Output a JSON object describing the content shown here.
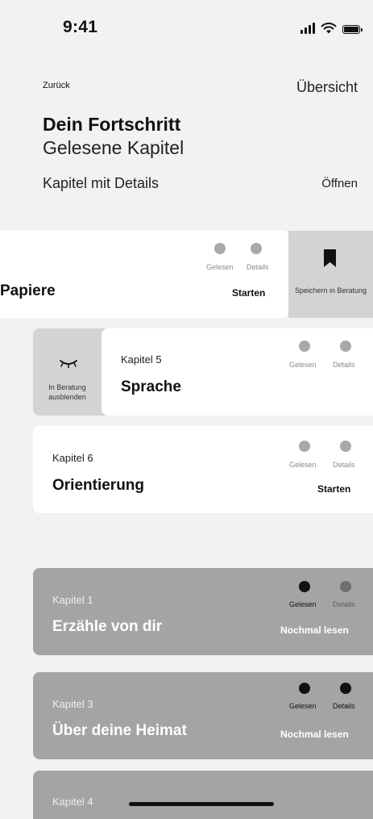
{
  "status_bar": {
    "time": "9:41"
  },
  "header": {
    "back": "Zurück",
    "overview": "Übersicht",
    "title": "Dein Fortschritt",
    "subtitle": "Gelesene Kapitel",
    "chapter_details": "Kapitel mit Details",
    "open": "Öffnen"
  },
  "cards": {
    "papiere": {
      "title": "Papiere",
      "read_label": "Gelesen",
      "details_label": "Details",
      "action": "Starten",
      "swipe_action": "Speichern in Beratung",
      "swipe_icon": "bookmark-icon"
    },
    "sprache": {
      "chapter": "Kapitel 5",
      "title": "Sprache",
      "read_label": "Gelesen",
      "details_label": "Details",
      "swipe_action": "In Beratung ausblenden",
      "swipe_icon": "eye-closed-icon"
    },
    "orientierung": {
      "chapter": "Kapitel 6",
      "title": "Orientierung",
      "read_label": "Gelesen",
      "details_label": "Details",
      "action": "Starten"
    },
    "erzaehle": {
      "chapter": "Kapitel 1",
      "title": "Erzähle von dir",
      "read_label": "Gelesen",
      "details_label": "Details",
      "action": "Nochmal lesen"
    },
    "heimat": {
      "chapter": "Kapitel 3",
      "title": "Über deine Heimat",
      "read_label": "Gelesen",
      "details_label": "Details",
      "action": "Nochmal lesen"
    },
    "kapitel4": {
      "chapter": "Kapitel 4"
    }
  }
}
